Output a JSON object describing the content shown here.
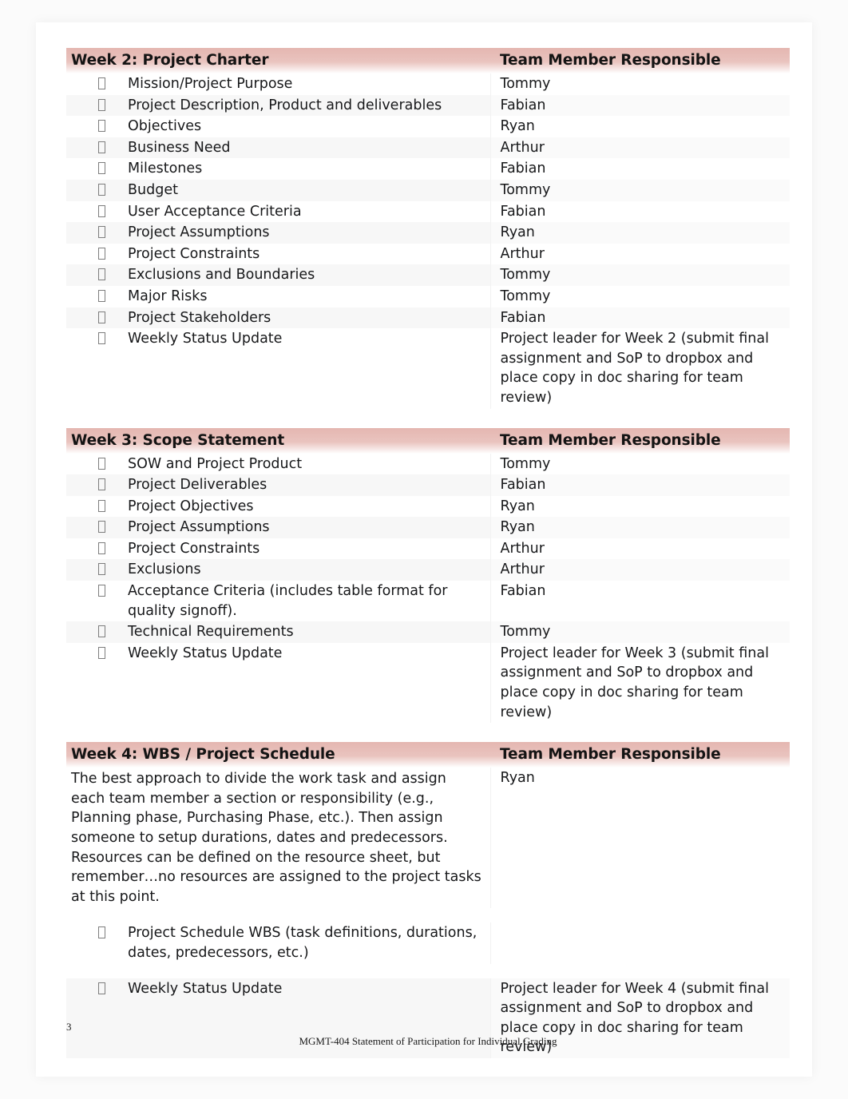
{
  "document": {
    "page_number": "3",
    "footer_note": "MGMT-404 Statement of Participation for Individual Grading",
    "bullet_glyph": "tofu-box"
  },
  "colors": {
    "header_band": "#e2b0aa",
    "page_background": "#ffffff",
    "canvas_background": "#fbfbfb",
    "row_stripe": "#f7f7f7",
    "text": "#17181a"
  },
  "sections": [
    {
      "id": "week-2",
      "title": "Week 2: Project Charter",
      "right_header": "Team Member Responsible",
      "rows": [
        {
          "task": "Mission/Project Purpose",
          "owner": "Tommy"
        },
        {
          "task": "Project Description, Product and deliverables",
          "owner": "Fabian"
        },
        {
          "task": "Objectives",
          "owner": "Ryan"
        },
        {
          "task": "Business Need",
          "owner": "Arthur"
        },
        {
          "task": "Milestones",
          "owner": "Fabian"
        },
        {
          "task": "Budget",
          "owner": "Tommy"
        },
        {
          "task": "User Acceptance Criteria",
          "owner": "Fabian"
        },
        {
          "task": "Project Assumptions",
          "owner": "Ryan"
        },
        {
          "task": "Project Constraints",
          "owner": "Arthur"
        },
        {
          "task": "Exclusions and Boundaries",
          "owner": "Tommy"
        },
        {
          "task": "Major Risks",
          "owner": "Tommy"
        },
        {
          "task": "Project Stakeholders",
          "owner": "Fabian"
        },
        {
          "task": "Weekly Status Update",
          "owner": "Project leader for Week 2 (submit final assignment and SoP to dropbox and place copy in doc sharing for team review)"
        }
      ]
    },
    {
      "id": "week-3",
      "title": "Week 3: Scope Statement",
      "right_header": "Team Member Responsible",
      "rows": [
        {
          "task": "SOW and Project Product",
          "owner": "Tommy"
        },
        {
          "task": "Project Deliverables",
          "owner": "Fabian"
        },
        {
          "task": "Project Objectives",
          "owner": "Ryan"
        },
        {
          "task": "Project Assumptions",
          "owner": "Ryan"
        },
        {
          "task": "Project Constraints",
          "owner": "Arthur"
        },
        {
          "task": "Exclusions",
          "owner": "Arthur"
        },
        {
          "task": "Acceptance Criteria (includes table format for quality signoff).",
          "owner": "Fabian"
        },
        {
          "task": "Technical Requirements",
          "owner": "Tommy"
        },
        {
          "task": "Weekly Status Update",
          "owner": "Project leader for Week 3 (submit final assignment and SoP to dropbox and place copy in doc sharing for team review)"
        }
      ]
    },
    {
      "id": "week-4",
      "title": "Week 4: WBS / Project Schedule",
      "right_header": "Team Member Responsible",
      "intro_paragraph": "The best approach to divide the work task and assign each team member a section or responsibility (e.g., Planning phase, Purchasing Phase, etc.). Then assign someone to setup durations, dates and predecessors. Resources can be defined on the resource sheet, but remember…no resources are assigned to the project tasks at this point.",
      "intro_owner": "Ryan",
      "rows": [
        {
          "task": "Project Schedule WBS (task definitions, durations, dates, predecessors, etc.)",
          "owner": ""
        },
        {
          "task": "Weekly Status Update",
          "owner": "Project leader for Week 4 (submit final assignment and SoP to dropbox and place copy in doc sharing for team review)"
        }
      ]
    }
  ]
}
